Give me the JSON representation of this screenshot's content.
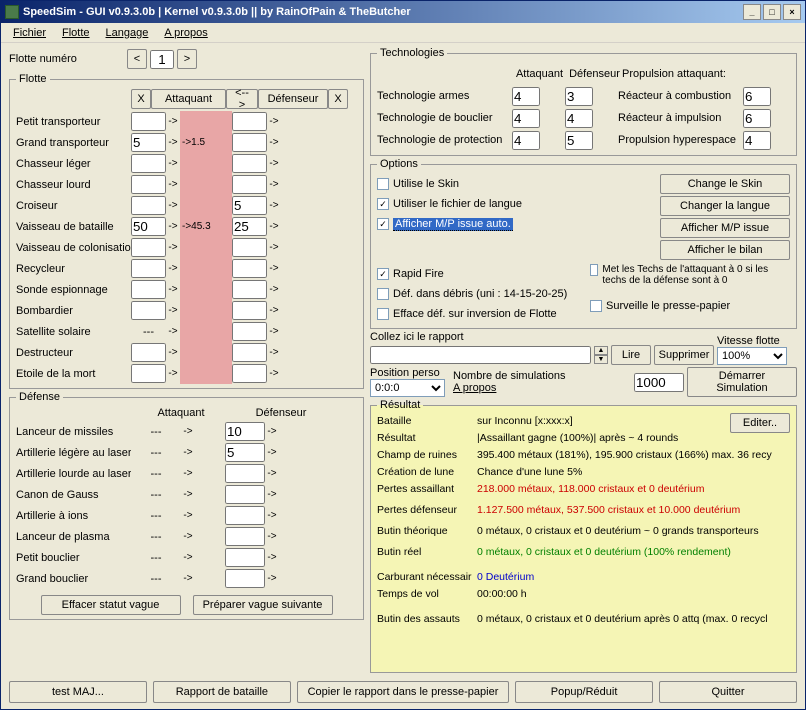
{
  "title": "SpeedSim - GUI v0.9.3.0b | Kernel v0.9.3.0b  ||  by RainOfPain & TheButcher",
  "menu": {
    "file": "Fichier",
    "fleet": "Flotte",
    "lang": "Langage",
    "about": "A propos"
  },
  "fleetNum": {
    "label": "Flotte numéro",
    "val": "1",
    "prev": "<",
    "next": ">"
  },
  "section": {
    "fleet": "Flotte",
    "defense": "Défense",
    "tech": "Technologies",
    "options": "Options",
    "result": "Résultat"
  },
  "headers": {
    "attacker": "Attaquant",
    "defender": "Défenseur",
    "swap": "<-->",
    "x": "X",
    "propAtt": "Propulsion attaquant:"
  },
  "fleetRows": [
    {
      "name": "Petit transporteur",
      "a": "",
      "mid": "",
      "d": ""
    },
    {
      "name": "Grand transporteur",
      "a": "5",
      "mid": "->1.5",
      "d": ""
    },
    {
      "name": "Chasseur léger",
      "a": "",
      "mid": "",
      "d": ""
    },
    {
      "name": "Chasseur lourd",
      "a": "",
      "mid": "",
      "d": ""
    },
    {
      "name": "Croiseur",
      "a": "",
      "mid": "",
      "d": "5"
    },
    {
      "name": "Vaisseau de bataille",
      "a": "50",
      "mid": "->45.3",
      "d": "25"
    },
    {
      "name": "Vaisseau de colonisation",
      "a": "",
      "mid": "",
      "d": ""
    },
    {
      "name": "Recycleur",
      "a": "",
      "mid": "",
      "d": ""
    },
    {
      "name": "Sonde espionnage",
      "a": "",
      "mid": "",
      "d": ""
    },
    {
      "name": "Bombardier",
      "a": "",
      "mid": "",
      "d": ""
    },
    {
      "name": "Satellite solaire",
      "a": "---",
      "mid": "",
      "d": ""
    },
    {
      "name": "Destructeur",
      "a": "",
      "mid": "",
      "d": ""
    },
    {
      "name": "Etoile de la mort",
      "a": "",
      "mid": "",
      "d": ""
    }
  ],
  "defRows": [
    {
      "name": "Lanceur de missiles",
      "d": "10"
    },
    {
      "name": "Artillerie légère au laser",
      "d": "5"
    },
    {
      "name": "Artillerie lourde au laser",
      "d": ""
    },
    {
      "name": "Canon de Gauss",
      "d": ""
    },
    {
      "name": "Artillerie à ions",
      "d": ""
    },
    {
      "name": "Lanceur de plasma",
      "d": ""
    },
    {
      "name": "Petit bouclier",
      "d": ""
    },
    {
      "name": "Grand bouclier",
      "d": ""
    }
  ],
  "waveBtns": {
    "clear": "Effacer statut vague",
    "prep": "Préparer vague suivante"
  },
  "tech": {
    "weapons": "Technologie armes",
    "shield": "Technologie de bouclier",
    "armor": "Technologie de protection",
    "wA": "4",
    "wD": "3",
    "sA": "4",
    "sD": "4",
    "aA": "4",
    "aD": "5",
    "comb": "Réacteur à combustion",
    "imp": "Réacteur à impulsion",
    "hyp": "Propulsion hyperespace",
    "combV": "6",
    "impV": "6",
    "hypV": "4"
  },
  "opts": {
    "skin": "Utilise le Skin",
    "lang": "Utiliser le fichier de langue",
    "mp": "Afficher M/P issue auto.",
    "rapid": "Rapid Fire",
    "debris": "Déf. dans débris (uni : 14-15-20-25)",
    "erase": "Efface déf. sur inversion de Flotte",
    "techzero": "Met les Techs de l'attaquant à 0 si les techs de la défense sont à 0",
    "clip": "Surveille le presse-papier",
    "btnSkin": "Change le Skin",
    "btnLang": "Changer la langue",
    "btnMP": "Afficher M/P issue",
    "btnBilan": "Afficher le bilan"
  },
  "report": {
    "label": "Collez ici le rapport",
    "read": "Lire",
    "del": "Supprimer",
    "speedLbl": "Vitesse flotte",
    "speedVal": "100%"
  },
  "pos": {
    "label": "Position perso",
    "val": "0:0:0",
    "simLbl": "Nombre de simulations",
    "apropos": "A propos",
    "simVal": "1000",
    "start": "Démarrer Simulation"
  },
  "res": {
    "edit": "Editer..",
    "battle": "Bataille",
    "battleV": "sur Inconnu [x:xxx:x]",
    "result": "Résultat",
    "resultV": "|Assaillant gagne (100%)| après ~ 4 rounds",
    "debris": "Champ de ruines",
    "debrisV": "395.400 métaux (181%), 195.900 cristaux (166%) max. 36 recy",
    "moon": "Création de lune",
    "moonV": "Chance d'une lune 5%",
    "lossA": "Pertes assaillant",
    "lossAV": "218.000 métaux, 118.000 cristaux et 0 deutérium",
    "lossD": "Pertes défenseur",
    "lossDV": "1.127.500 métaux, 537.500 cristaux et 10.000 deutérium",
    "lootT": "Butin théorique",
    "lootTV": "0 métaux, 0 cristaux et 0 deutérium ~ 0 grands transporteurs",
    "lootR": "Butin réel",
    "lootRV": "0 métaux, 0 cristaux et 0 deutérium (100% rendement)",
    "fuel": "Carburant nécessair",
    "fuelV": "0 Deutérium",
    "time": "Temps de vol",
    "timeV": "00:00:00 h",
    "assault": "Butin des assauts",
    "assaultV": "0 métaux, 0 cristaux et 0 deutérium après 0 attq (max. 0 recycl"
  },
  "bottom": {
    "test": "test MAJ...",
    "report": "Rapport de bataille",
    "copy": "Copier le rapport dans le presse-papier",
    "popup": "Popup/Réduit",
    "quit": "Quitter"
  }
}
